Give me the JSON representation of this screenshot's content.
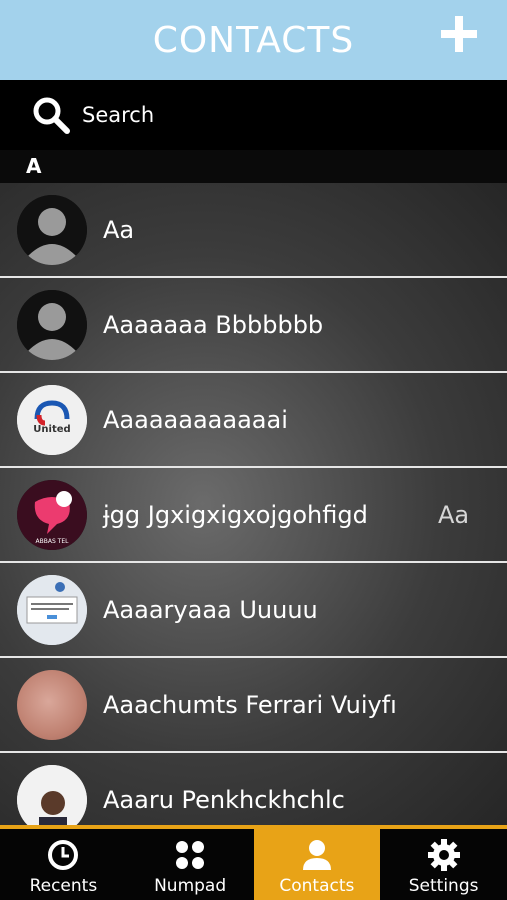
{
  "header": {
    "title": "CONTACTS",
    "add_icon": "plus-icon"
  },
  "search": {
    "placeholder": "Search",
    "icon": "search-icon"
  },
  "section": {
    "letter": "A"
  },
  "contacts": [
    {
      "name": "Aa",
      "avatar": "default-avatar",
      "extra": ""
    },
    {
      "name": "Aaaaaaa Bbbbbbb",
      "avatar": "default-avatar",
      "extra": ""
    },
    {
      "name": "Aaaaaaaaaaaai",
      "avatar": "united-logo-avatar",
      "extra": ""
    },
    {
      "name": "ɉgg Jgxigxigxojgohfigd",
      "avatar": "abbas-tel-avatar",
      "extra": "Aa"
    },
    {
      "name": "Aaaaryaaa Uuuuu",
      "avatar": "screenshot-avatar",
      "extra": ""
    },
    {
      "name": "Aaachumts Ferrari Vuiyfı",
      "avatar": "photo-avatar",
      "extra": ""
    },
    {
      "name": "Aaaru Penkhckhchlc",
      "avatar": "person-photo-avatar",
      "extra": ""
    }
  ],
  "avatar_text": {
    "united": "United",
    "abbas": "ABBAS TEL"
  },
  "tabs": [
    {
      "label": "Recents",
      "icon": "clock-icon",
      "active": false
    },
    {
      "label": "Numpad",
      "icon": "dots-grid-icon",
      "active": false
    },
    {
      "label": "Contacts",
      "icon": "person-icon",
      "active": true
    },
    {
      "label": "Settings",
      "icon": "gear-icon",
      "active": false
    }
  ],
  "colors": {
    "header": "#a3d2ec",
    "accent": "#e8a317"
  }
}
